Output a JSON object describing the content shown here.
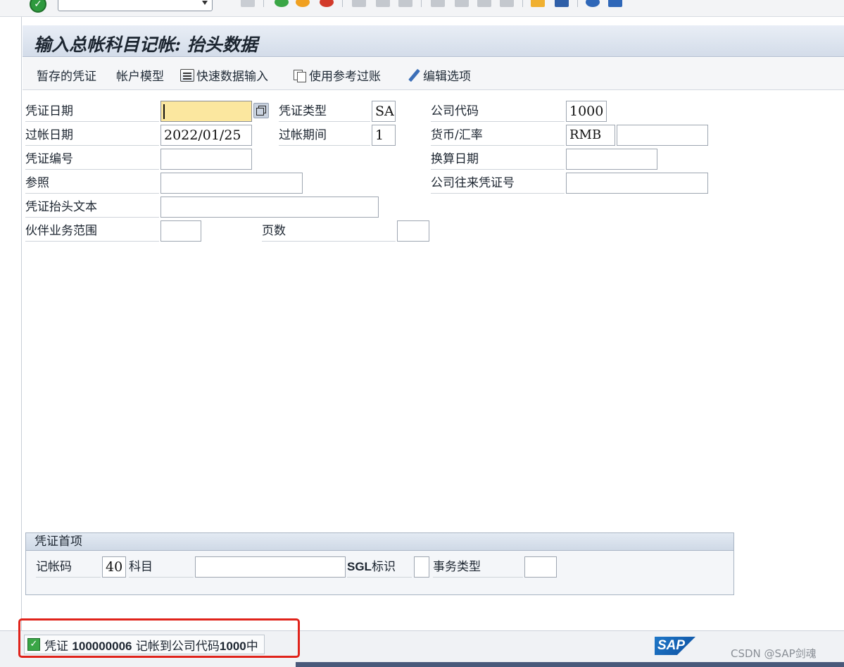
{
  "title": "输入总帐科目记帐: 抬头数据",
  "toolbar": {
    "items": [
      {
        "label": "暂存的凭证"
      },
      {
        "label": "帐户模型"
      },
      {
        "label": "快速数据输入",
        "icon": "quick-entry-icon"
      },
      {
        "label": "使用参考过账",
        "icon": "copy-icon"
      },
      {
        "label": "编辑选项",
        "icon": "pencil-icon"
      }
    ]
  },
  "header": {
    "doc_date": {
      "label": "凭证日期",
      "value": ""
    },
    "doc_type": {
      "label": "凭证类型",
      "value": "SA"
    },
    "company_code": {
      "label": "公司代码",
      "value": "1000"
    },
    "posting_date": {
      "label": "过帐日期",
      "value": "2022/01/25"
    },
    "posting_period": {
      "label": "过帐期间",
      "value": "1"
    },
    "currency": {
      "label": "货币/汇率",
      "value": "RMB",
      "rate": ""
    },
    "doc_number": {
      "label": "凭证编号",
      "value": ""
    },
    "translation_date": {
      "label": "换算日期",
      "value": ""
    },
    "reference": {
      "label": "参照",
      "value": ""
    },
    "intercompany_doc": {
      "label": "公司往来凭证号",
      "value": ""
    },
    "header_text": {
      "label": "凭证抬头文本",
      "value": ""
    },
    "partner_ba": {
      "label": "伙伴业务范围",
      "value": ""
    },
    "pages": {
      "label": "页数",
      "value": ""
    }
  },
  "first_item": {
    "title": "凭证首项",
    "posting_key": {
      "label": "记帐码",
      "value": "40"
    },
    "account": {
      "label": "科目",
      "value": ""
    },
    "sgl_ind": {
      "label_sgl": "SGL",
      "label_rest": "标识",
      "value": ""
    },
    "transaction_type": {
      "label": "事务类型",
      "value": ""
    }
  },
  "status": {
    "prefix": "凭证",
    "doc_no": "100000006",
    "middle": "记帐到公司代码",
    "company": "1000",
    "suffix": "中"
  },
  "logo_text": "SAP",
  "watermark": "CSDN @SAP剑魂",
  "colors": {
    "active_field": "#fbe79f",
    "highlight": "#e0231b",
    "ok_green": "#3aa646"
  }
}
